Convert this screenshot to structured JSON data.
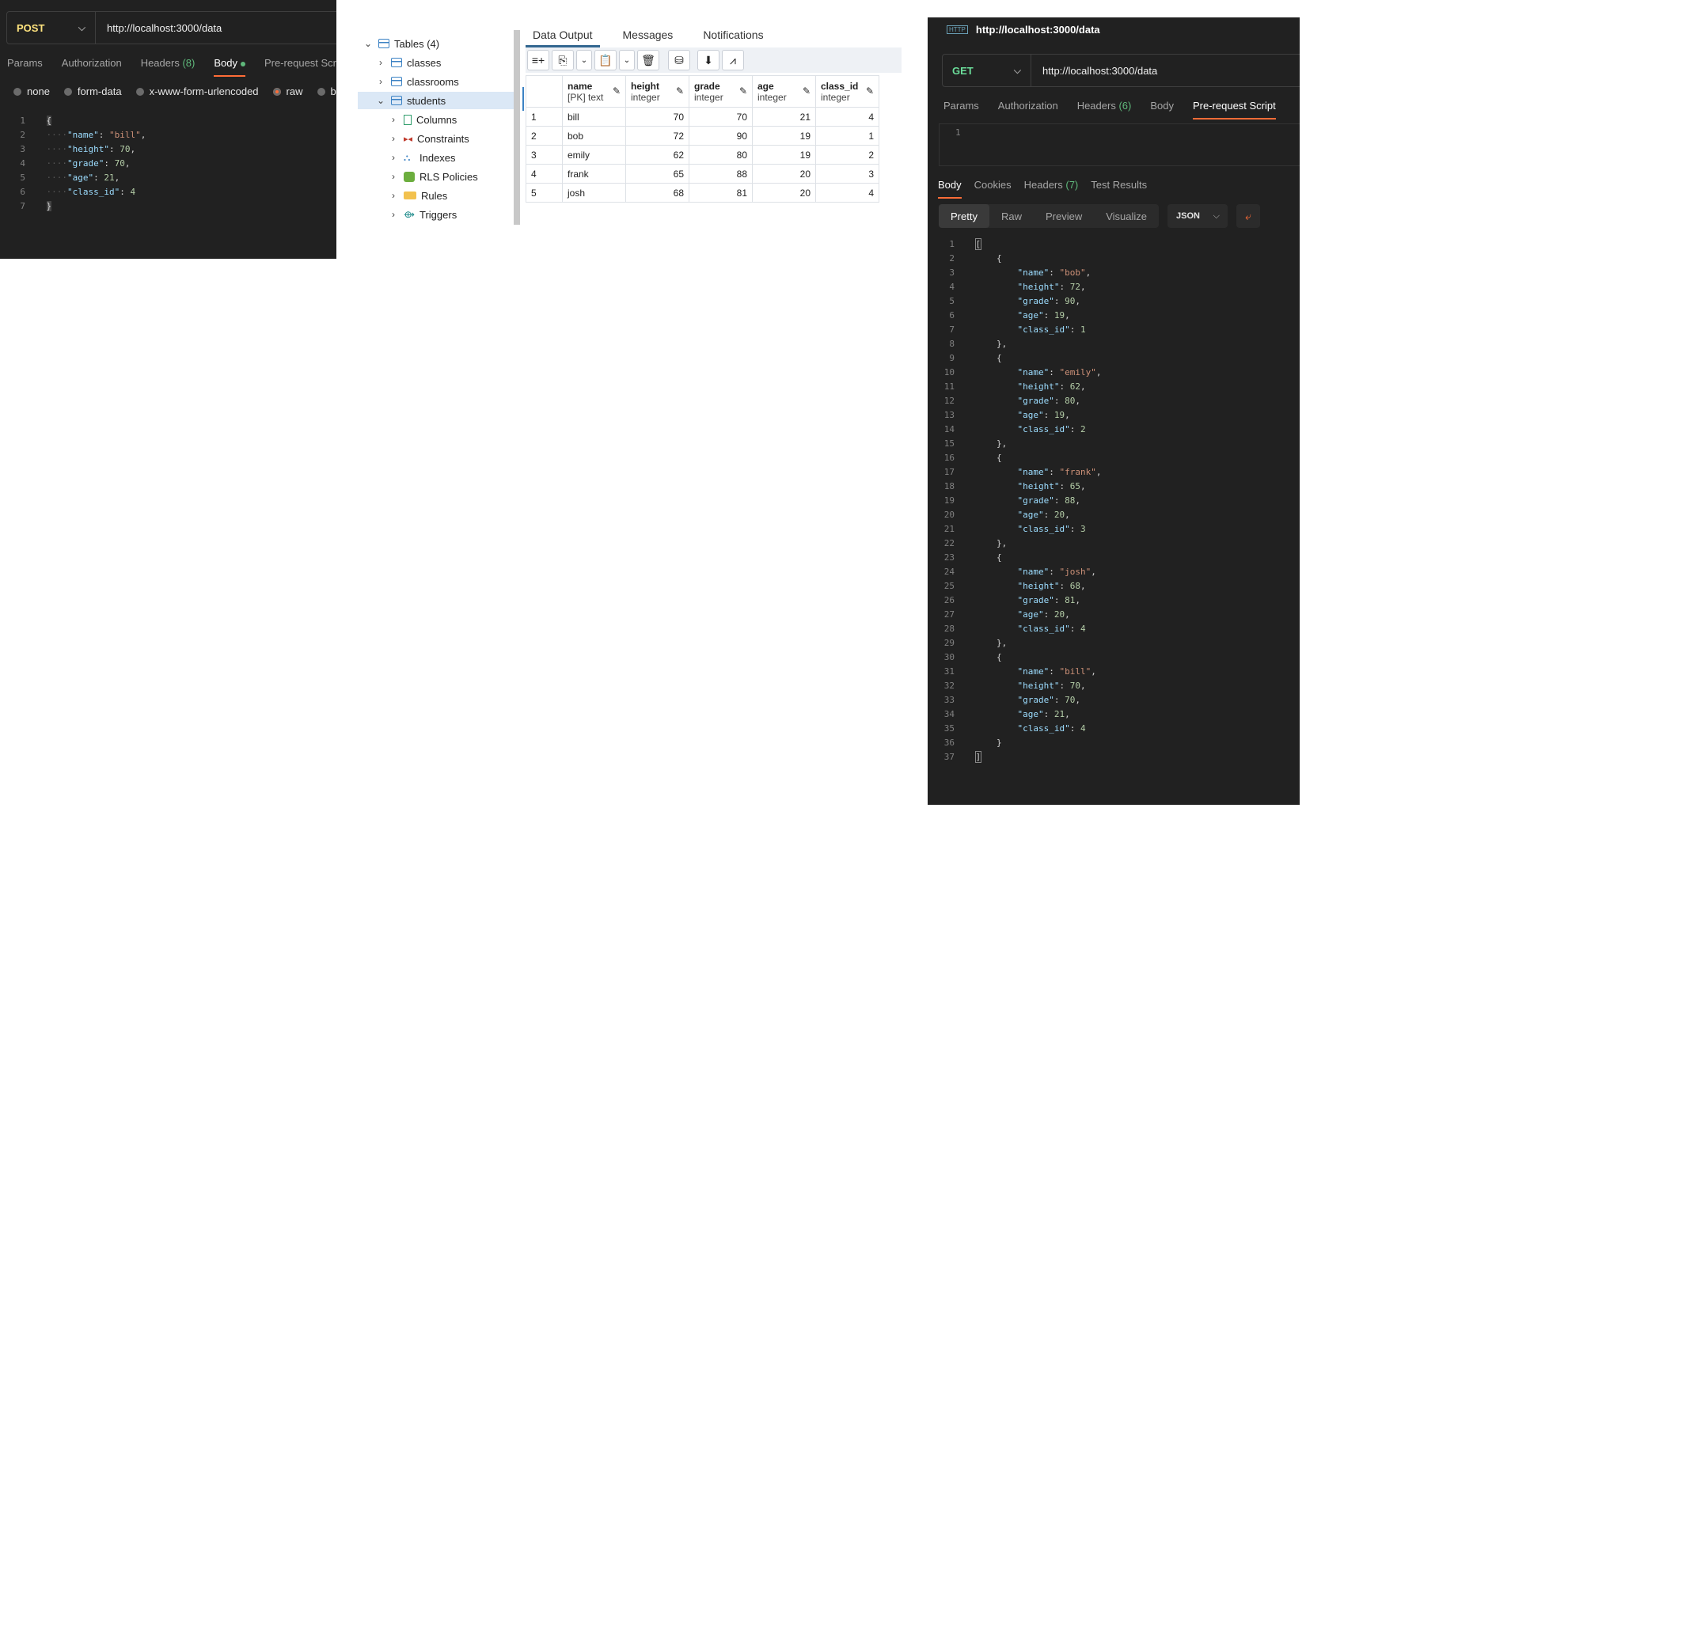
{
  "post_panel": {
    "method": "POST",
    "url": "http://localhost:3000/data",
    "tabs": [
      {
        "label": "Params"
      },
      {
        "label": "Authorization"
      },
      {
        "label": "Headers",
        "count": "(8)"
      },
      {
        "label": "Body"
      },
      {
        "label": "Pre-request Scr"
      }
    ],
    "body_types": [
      "none",
      "form-data",
      "x-www-form-urlencoded",
      "raw",
      "b"
    ],
    "body_lines": [
      {
        "n": "1",
        "t": "{"
      },
      {
        "n": "2",
        "k": "\"name\"",
        "v": "\"bill\"",
        "vt": "s",
        "c": ","
      },
      {
        "n": "3",
        "k": "\"height\"",
        "v": "70",
        "vt": "n",
        "c": ","
      },
      {
        "n": "4",
        "k": "\"grade\"",
        "v": "70",
        "vt": "n",
        "c": ","
      },
      {
        "n": "5",
        "k": "\"age\"",
        "v": "21",
        "vt": "n",
        "c": ","
      },
      {
        "n": "6",
        "k": "\"class_id\"",
        "v": "4",
        "vt": "n",
        "c": ""
      },
      {
        "n": "7",
        "t": "}"
      }
    ]
  },
  "pgadmin": {
    "tree": {
      "root": "Tables (4)",
      "tables": [
        "classes",
        "classrooms",
        "students"
      ],
      "children": [
        "Columns",
        "Constraints",
        "Indexes",
        "RLS Policies",
        "Rules",
        "Triggers"
      ]
    },
    "tabs": [
      "Data Output",
      "Messages",
      "Notifications"
    ],
    "columns": [
      {
        "name": "name",
        "type": "[PK] text"
      },
      {
        "name": "height",
        "type": "integer"
      },
      {
        "name": "grade",
        "type": "integer"
      },
      {
        "name": "age",
        "type": "integer"
      },
      {
        "name": "class_id",
        "type": "integer"
      }
    ],
    "rows": [
      [
        "1",
        "bill",
        "70",
        "70",
        "21",
        "4"
      ],
      [
        "2",
        "bob",
        "72",
        "90",
        "19",
        "1"
      ],
      [
        "3",
        "emily",
        "62",
        "80",
        "19",
        "2"
      ],
      [
        "4",
        "frank",
        "65",
        "88",
        "20",
        "3"
      ],
      [
        "5",
        "josh",
        "68",
        "81",
        "20",
        "4"
      ]
    ]
  },
  "get_panel": {
    "title": "http://localhost:3000/data",
    "method": "GET",
    "url": "http://localhost:3000/data",
    "tabs": [
      {
        "label": "Params"
      },
      {
        "label": "Authorization"
      },
      {
        "label": "Headers",
        "count": "(6)"
      },
      {
        "label": "Body"
      },
      {
        "label": "Pre-request Script"
      }
    ],
    "script_line": "1",
    "response_tabs": [
      {
        "label": "Body"
      },
      {
        "label": "Cookies"
      },
      {
        "label": "Headers",
        "count": "(7)"
      },
      {
        "label": "Test Results"
      }
    ],
    "view_modes": [
      "Pretty",
      "Raw",
      "Preview",
      "Visualize"
    ],
    "format": "JSON",
    "response": [
      {
        "name": "bob",
        "height": 72,
        "grade": 90,
        "age": 19,
        "class_id": 1
      },
      {
        "name": "emily",
        "height": 62,
        "grade": 80,
        "age": 19,
        "class_id": 2
      },
      {
        "name": "frank",
        "height": 65,
        "grade": 88,
        "age": 20,
        "class_id": 3
      },
      {
        "name": "josh",
        "height": 68,
        "grade": 81,
        "age": 20,
        "class_id": 4
      },
      {
        "name": "bill",
        "height": 70,
        "grade": 70,
        "age": 21,
        "class_id": 4
      }
    ]
  },
  "colors": {
    "postman_bg": "#212121",
    "accent": "#ff6c37",
    "post_method": "#ffe47e",
    "get_method": "#6bdd9a",
    "pg_selected": "#dbe8f6"
  }
}
